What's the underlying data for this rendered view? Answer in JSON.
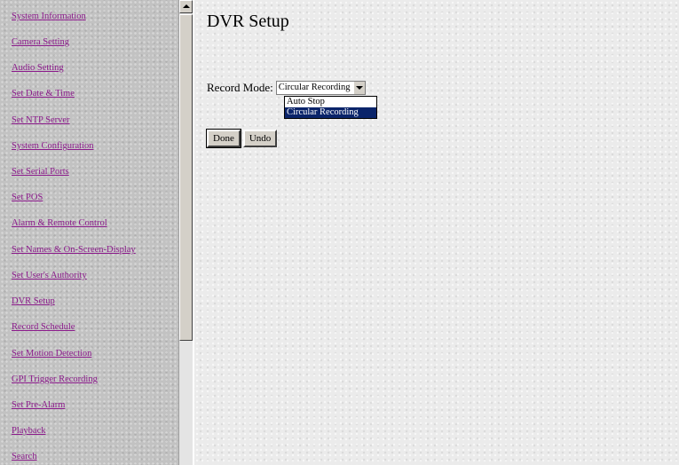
{
  "sidebar": {
    "items": [
      {
        "label": "System Information"
      },
      {
        "label": "Camera Setting"
      },
      {
        "label": "Audio Setting"
      },
      {
        "label": "Set Date & Time"
      },
      {
        "label": "Set NTP Server"
      },
      {
        "label": "System Configuration"
      },
      {
        "label": "Set Serial Ports"
      },
      {
        "label": "Set POS"
      },
      {
        "label": "Alarm & Remote Control"
      },
      {
        "label": "Set Names & On-Screen-Display"
      },
      {
        "label": "Set User's Authority"
      },
      {
        "label": "DVR Setup"
      },
      {
        "label": "Record Schedule"
      },
      {
        "label": "Set Motion Detection"
      },
      {
        "label": "GPI Trigger Recording"
      },
      {
        "label": "Set Pre-Alarm"
      },
      {
        "label": "Playback"
      },
      {
        "label": "Search"
      }
    ]
  },
  "main": {
    "title": "DVR Setup",
    "record_mode": {
      "label": "Record Mode:",
      "selected_value": "Circular Recording",
      "options": [
        "Auto Stop",
        "Circular Recording"
      ]
    },
    "buttons": {
      "done_label": "Done",
      "undo_label": "Undo"
    }
  },
  "colors": {
    "link": "#8b1a8b",
    "selection_highlight": "#0a246a"
  }
}
